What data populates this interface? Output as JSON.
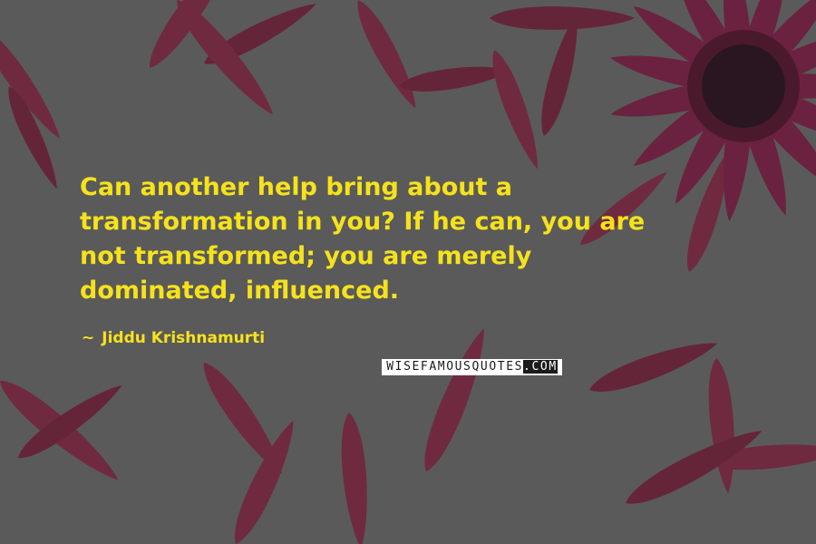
{
  "colors": {
    "background": "#5a5a5a",
    "petal": "#6f2a40",
    "petal_dark": "#5e2235",
    "flower_center": "#2a1620",
    "quote_text": "#f6e21c"
  },
  "quote": {
    "lines": [
      "Can another help bring about a",
      "transformation in you? If he can, you are",
      "not transformed; you are merely",
      "dominated, influenced."
    ]
  },
  "author": {
    "dash": "~",
    "name": "Jiddu Krishnamurti"
  },
  "watermark": {
    "text_light": "WISEFAMOUSQUOTES",
    "text_dark": ".COM"
  }
}
